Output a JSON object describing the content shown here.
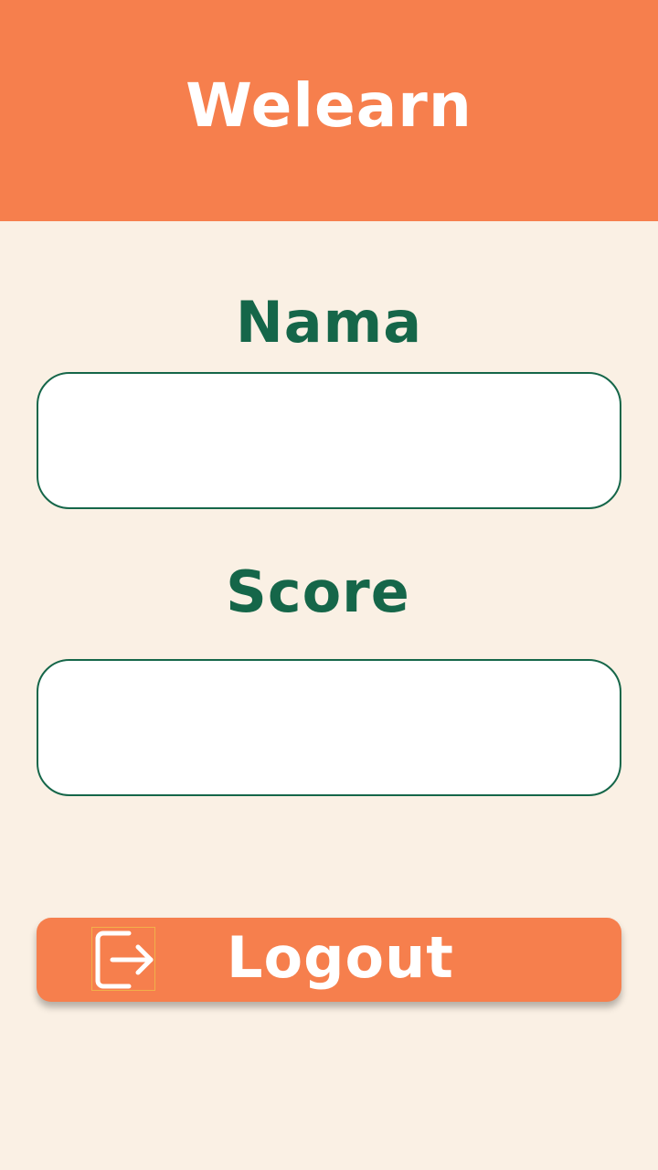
{
  "header": {
    "title": "Welearn"
  },
  "form": {
    "nama": {
      "label": "Nama",
      "value": "",
      "placeholder": ""
    },
    "score": {
      "label": "Score",
      "value": "",
      "placeholder": ""
    }
  },
  "logout": {
    "label": "Logout",
    "icon": "logout-icon"
  },
  "colors": {
    "header": "#F67F4D",
    "background": "#FAF0E4",
    "accent_green": "#156649",
    "button": "#F67F4D",
    "text_light": "#FFFFFF"
  }
}
